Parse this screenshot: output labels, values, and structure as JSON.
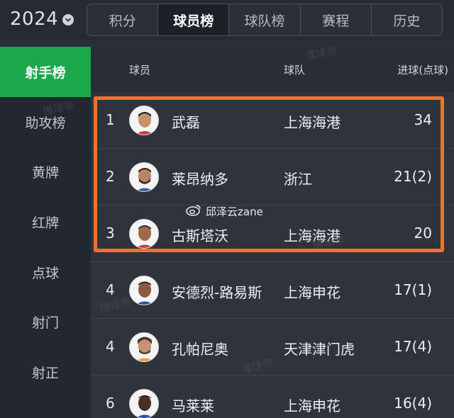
{
  "season": {
    "year": "2024"
  },
  "tabs": [
    {
      "label": "积分",
      "active": false
    },
    {
      "label": "球员榜",
      "active": true
    },
    {
      "label": "球队榜",
      "active": false
    },
    {
      "label": "赛程",
      "active": false
    },
    {
      "label": "历史",
      "active": false
    }
  ],
  "sidebar": {
    "items": [
      {
        "label": "射手榜",
        "active": true
      },
      {
        "label": "助攻榜",
        "active": false
      },
      {
        "label": "黄牌",
        "active": false
      },
      {
        "label": "红牌",
        "active": false
      },
      {
        "label": "点球",
        "active": false
      },
      {
        "label": "射门",
        "active": false
      },
      {
        "label": "射正",
        "active": false
      }
    ]
  },
  "table": {
    "headers": {
      "player": "球员",
      "team": "球队",
      "goals": "进球(点球)"
    },
    "rows": [
      {
        "rank": "1",
        "name": "武磊",
        "team": "上海海港",
        "goals": "34"
      },
      {
        "rank": "2",
        "name": "莱昂纳多",
        "team": "浙江",
        "goals": "21(2)"
      },
      {
        "rank": "3",
        "name": "古斯塔沃",
        "team": "上海海港",
        "goals": "20"
      },
      {
        "rank": "4",
        "name": "安德烈-路易斯",
        "team": "上海申花",
        "goals": "17(1)"
      },
      {
        "rank": "4",
        "name": "孔帕尼奥",
        "team": "天津津门虎",
        "goals": "17(4)"
      },
      {
        "rank": "6",
        "name": "马莱莱",
        "team": "上海申花",
        "goals": "16(4)"
      }
    ]
  },
  "overlay": {
    "weibo_user": "邱泽云zane",
    "watermark": "懂球帝"
  },
  "colors": {
    "accent_green": "#1aa84b",
    "highlight_orange": "#f0722c",
    "background": "#2b3038"
  }
}
